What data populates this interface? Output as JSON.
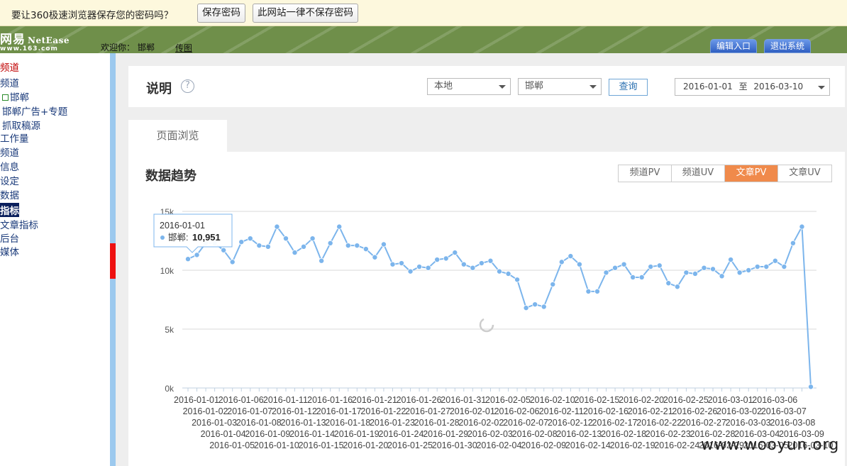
{
  "password_bar": {
    "message": "要让360极速浏览器保存您的密码吗？",
    "save_label": "保存密码",
    "never_label": "此网站一律不保存密码"
  },
  "header": {
    "logo_cn": "网易",
    "logo_en": "NetEase",
    "logo_url": "www.163.com",
    "welcome": "欢迎你：",
    "city": "邯郸",
    "link": "传图",
    "edit_entry": "编辑入口",
    "logout": "退出系统"
  },
  "sidebar": {
    "items": [
      {
        "label": "频道",
        "state": "active"
      },
      {
        "label": "频道"
      },
      {
        "label": "邯郸",
        "icon": "square-icon"
      },
      {
        "label": "邯郸广告+专题"
      },
      {
        "label": "抓取稿源"
      },
      {
        "label": "工作量"
      },
      {
        "label": "频道"
      },
      {
        "label": "信息"
      },
      {
        "label": "设定"
      },
      {
        "label": "数据"
      },
      {
        "label": "指标",
        "state": "highlight"
      },
      {
        "label": "文章指标"
      },
      {
        "label": "后台"
      },
      {
        "label": "媒体"
      }
    ]
  },
  "page": {
    "title": "说明",
    "help_icon": "question-circle-icon",
    "region_select": "本地",
    "city_select": "邯郸",
    "query_label": "查询",
    "date_from": "2016-01-01",
    "date_sep": "至",
    "date_to": "2016-03-10",
    "tab_label": "页面浏览"
  },
  "trend": {
    "title": "数据趋势",
    "tabs": [
      "频道PV",
      "频道UV",
      "文章PV",
      "文章UV"
    ],
    "active_tab": 2
  },
  "tooltip": {
    "date": "2016-01-01",
    "series": "邯郸",
    "value": "10,951"
  },
  "watermark": "www.wooyun.org",
  "colors": {
    "header_green": "#6f8f4a",
    "line_blue": "#7cb5ec",
    "accent_orange": "#f08a4b"
  },
  "chart_data": {
    "type": "line",
    "x_start": "2016-01-01",
    "x_end": "2016-03-10",
    "ylim": [
      0,
      15000
    ],
    "yticks": [
      "0k",
      "5k",
      "10k",
      "15k"
    ],
    "grid": true,
    "series": [
      {
        "name": "邯郸",
        "values": [
          10951,
          11300,
          12300,
          12300,
          11700,
          10700,
          12400,
          12700,
          12100,
          12000,
          13700,
          12700,
          11500,
          12000,
          12700,
          10800,
          12300,
          13700,
          12100,
          12100,
          11800,
          11100,
          12200,
          10500,
          10600,
          9900,
          10300,
          10200,
          10900,
          11000,
          11500,
          10500,
          10200,
          10600,
          10800,
          9900,
          9700,
          9200,
          6800,
          7100,
          6900,
          8800,
          10700,
          11200,
          10500,
          8200,
          8200,
          9800,
          10200,
          10500,
          9400,
          9400,
          10300,
          10400,
          8900,
          8600,
          9800,
          9700,
          10200,
          10100,
          9500,
          10900,
          9800,
          10000,
          10300,
          10300,
          10800,
          10300,
          12300,
          13700,
          100
        ]
      }
    ]
  }
}
